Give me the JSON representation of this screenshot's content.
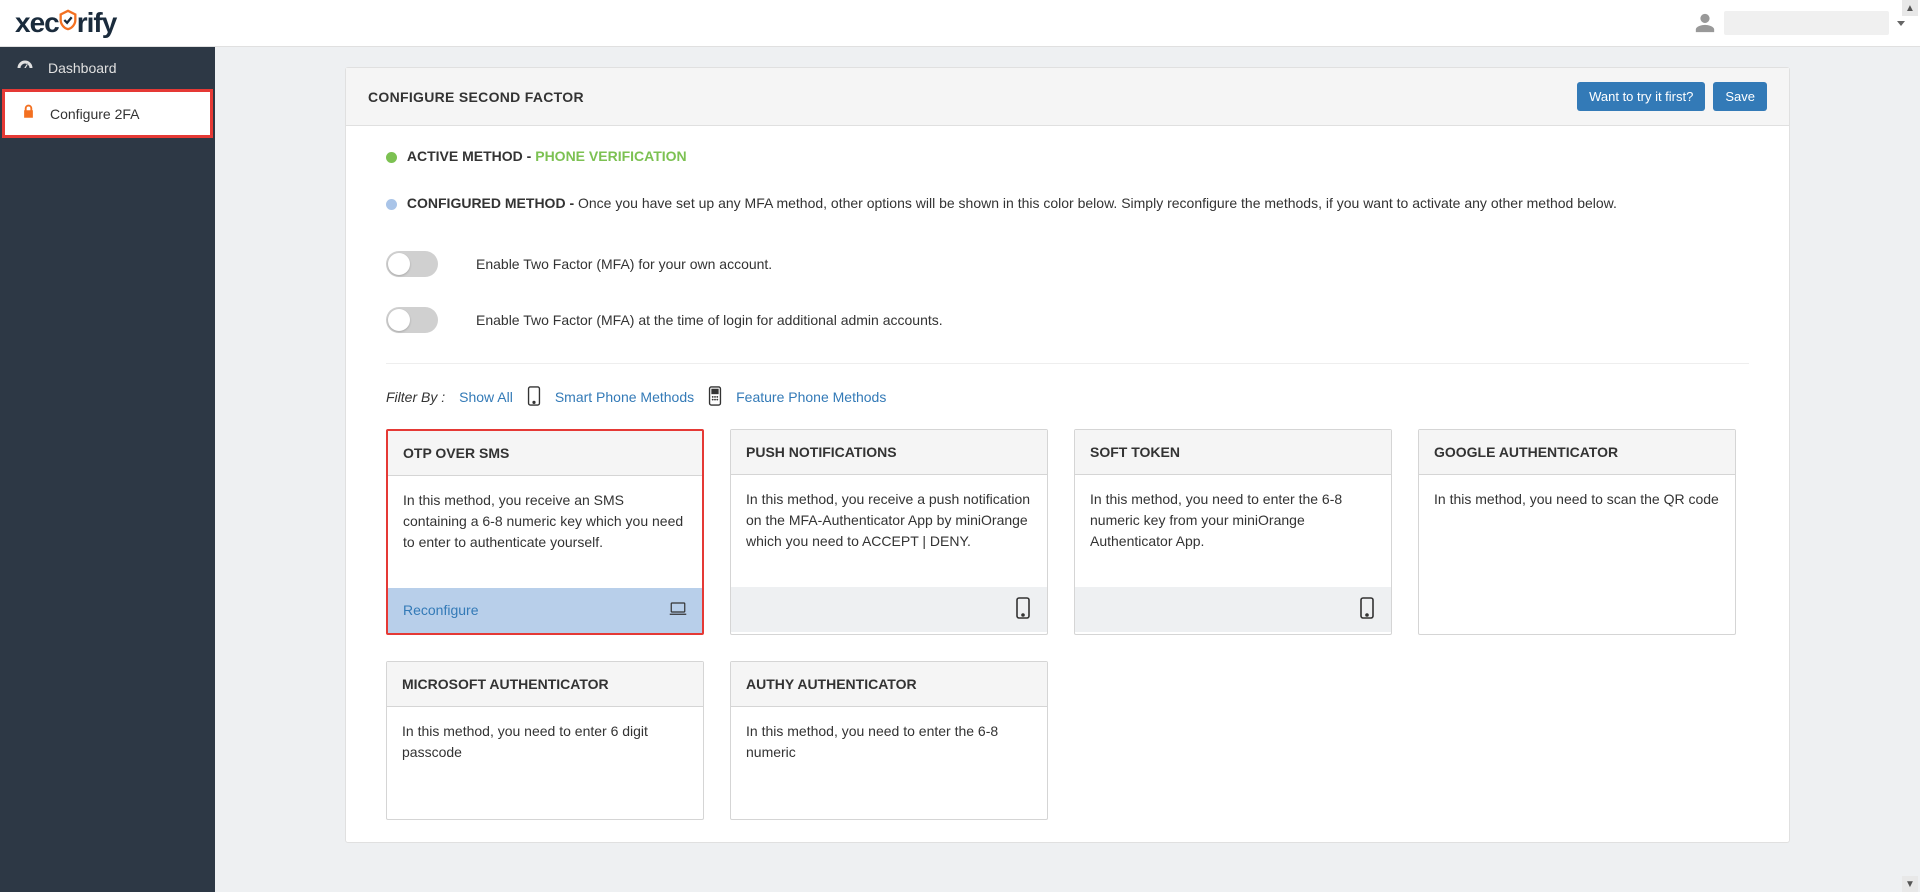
{
  "header": {
    "logo_part1": "xec",
    "logo_part2": "rify"
  },
  "sidebar": {
    "items": [
      {
        "label": "Dashboard"
      },
      {
        "label": "Configure 2FA"
      }
    ]
  },
  "panel": {
    "title": "CONFIGURE SECOND FACTOR",
    "btn_try": "Want to try it first?",
    "btn_save": "Save",
    "active_label": "ACTIVE METHOD - ",
    "active_value": "PHONE VERIFICATION",
    "configured_label": "CONFIGURED METHOD - ",
    "configured_desc": "Once you have set up any MFA method, other options will be shown in this color below. Simply reconfigure the methods, if you want to activate any other method below.",
    "toggle1": "Enable Two Factor (MFA) for your own account.",
    "toggle2": "Enable Two Factor (MFA) at the time of login for additional admin accounts.",
    "filter_label": "Filter By :",
    "filter_all": "Show All",
    "filter_smart": "Smart Phone Methods",
    "filter_feature": "Feature Phone Methods"
  },
  "cards": [
    {
      "title": "OTP OVER SMS",
      "desc": "In this method, you receive an SMS containing a 6-8 numeric key which you need to enter to authenticate yourself.",
      "action": "Reconfigure"
    },
    {
      "title": "PUSH NOTIFICATIONS",
      "desc": "In this method, you receive a push notification on the MFA-Authenticator App by miniOrange which you need to ACCEPT | DENY."
    },
    {
      "title": "SOFT TOKEN",
      "desc": "In this method, you need to enter the 6-8 numeric key from your miniOrange Authenticator App."
    },
    {
      "title": "GOOGLE AUTHENTICATOR",
      "desc": "In this method, you need to scan the QR code"
    },
    {
      "title": "MICROSOFT AUTHENTICATOR",
      "desc": "In this method, you need to enter 6 digit passcode"
    },
    {
      "title": "AUTHY AUTHENTICATOR",
      "desc": "In this method, you need to enter the 6-8 numeric"
    }
  ]
}
